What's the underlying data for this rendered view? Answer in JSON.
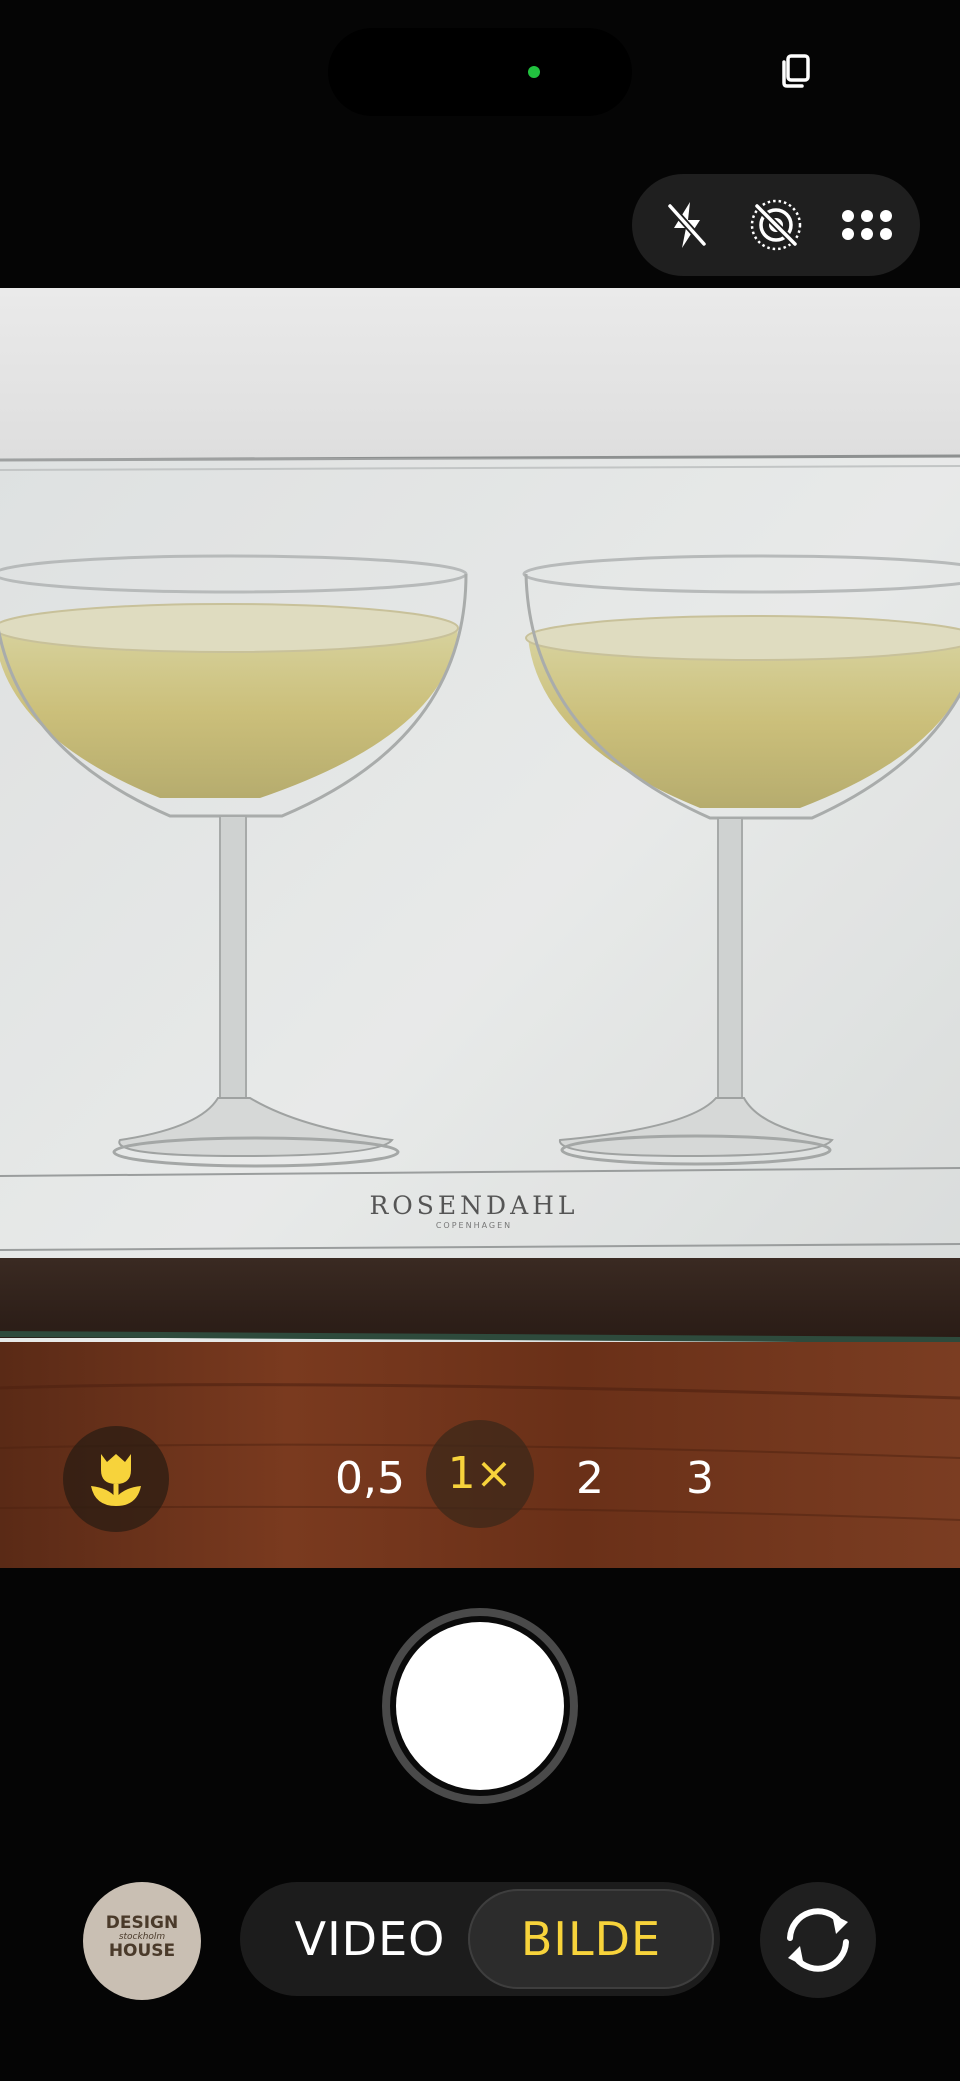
{
  "top": {
    "icons": [
      "live-photo-stack-icon",
      "flash-off-icon",
      "live-photo-off-icon",
      "more-options-icon"
    ],
    "recording_indicator_color": "#21c23f"
  },
  "viewfinder": {
    "scene_label_main": "ROSENDAHL",
    "scene_label_sub": "COPENHAGEN"
  },
  "zoom": {
    "macro_icon": "macro-tulip-icon",
    "options": [
      "0,5",
      "1×",
      "2",
      "3"
    ],
    "selected": "1×",
    "accent_color": "#f7d33b"
  },
  "bottom": {
    "thumbnail": {
      "line1": "DESIGN",
      "line2": "stockholm",
      "line3": "HOUSE"
    },
    "modes": [
      "VIDEO",
      "BILDE"
    ],
    "selected_mode": "BILDE",
    "mode_accent_color": "#f7d33b"
  }
}
